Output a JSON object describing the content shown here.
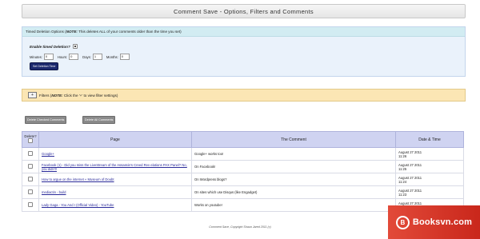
{
  "page_title": "Comment Save - Options, Filters and Comments",
  "timed_deletion": {
    "header_prefix": "Timed Deletion Options (",
    "header_note": "NOTE:",
    "header_suffix": " This deletes ALL of your comments older than the time you set)",
    "enable_label": "Enable timed Deletion?",
    "enabled": true,
    "fields": [
      {
        "label": "Minutes:",
        "value": "0"
      },
      {
        "label": "Hours:",
        "value": "0"
      },
      {
        "label": "Days:",
        "value": "1"
      },
      {
        "label": "Months:",
        "value": "0"
      }
    ],
    "set_button": "Set Deletion Time"
  },
  "filters": {
    "toggle": "+",
    "label_prefix": "Filters (",
    "label_note": "NOTE:",
    "label_suffix": " Click the '+' to view filter settings)"
  },
  "actions": {
    "delete_checked": "Delete Checked Comments",
    "delete_all": "Delete All Comments"
  },
  "table": {
    "headers": {
      "delete": "Delete?",
      "page": "Page",
      "comment": "The Comment",
      "date": "Date & Time"
    },
    "rows": [
      {
        "page": "Google+",
        "comment": "Google+ works too!",
        "date": "August 27 2011",
        "time": "11:26"
      },
      {
        "page": "Facebook (1) - Did you miss the LiveStream of the Assassin's Creed Rev elations PAX Panel? No, you didn't!",
        "comment": "On Facebook!",
        "date": "August 27 2011",
        "time": "11:25"
      },
      {
        "page": "How to argue on the internet « Museum of Doubt",
        "comment": "On Wordpress blogs?",
        "date": "August 27 2011",
        "time": "11:24"
      },
      {
        "page": "mediactin - build",
        "comment": "On sites which use Disqus (like Engadget)",
        "date": "August 27 2011",
        "time": "11:23"
      },
      {
        "page": "Lady Gaga - You And I (Official Video) - YouTube",
        "comment": "Works on youtube!",
        "date": "August 27 2011",
        "time": "11:22"
      }
    ]
  },
  "footer": "Comment Save, Copyright Shaun Jared 2011 (c)",
  "watermark": {
    "logo": "B",
    "text": "Booksvn.com"
  },
  "colors": {
    "navy_button": "#1c2a6e",
    "timed_header": "#d2ecf2",
    "filters_bg": "#fbe6b4",
    "table_header": "#cfd3f1",
    "watermark": "#d8342a"
  }
}
